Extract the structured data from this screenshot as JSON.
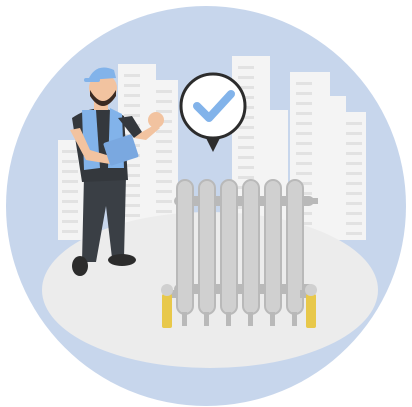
{
  "illustration": {
    "subject": "technician-inspecting-radiator",
    "badge_icon": "checkmark-icon",
    "colors": {
      "background_disc": "#c7d6ec",
      "floor": "#ececec",
      "buildings": "#f4f4f4",
      "building_windows": "#e2e2e2",
      "radiator": "#d0d0d0",
      "radiator_shadow": "#b9b9b9",
      "valve_brass": "#e8c84a",
      "worker_shirt": "#34383d",
      "worker_vest": "#82b3ea",
      "worker_pants": "#3a3f45",
      "worker_skin": "#f2c3a0",
      "worker_beard": "#3b2a22",
      "worker_cap": "#82b3ea",
      "clipboard": "#7aa8e0",
      "check_badge_bg": "#ffffff",
      "check_mark": "#82b3ea",
      "outline": "#2c2c2c"
    }
  }
}
